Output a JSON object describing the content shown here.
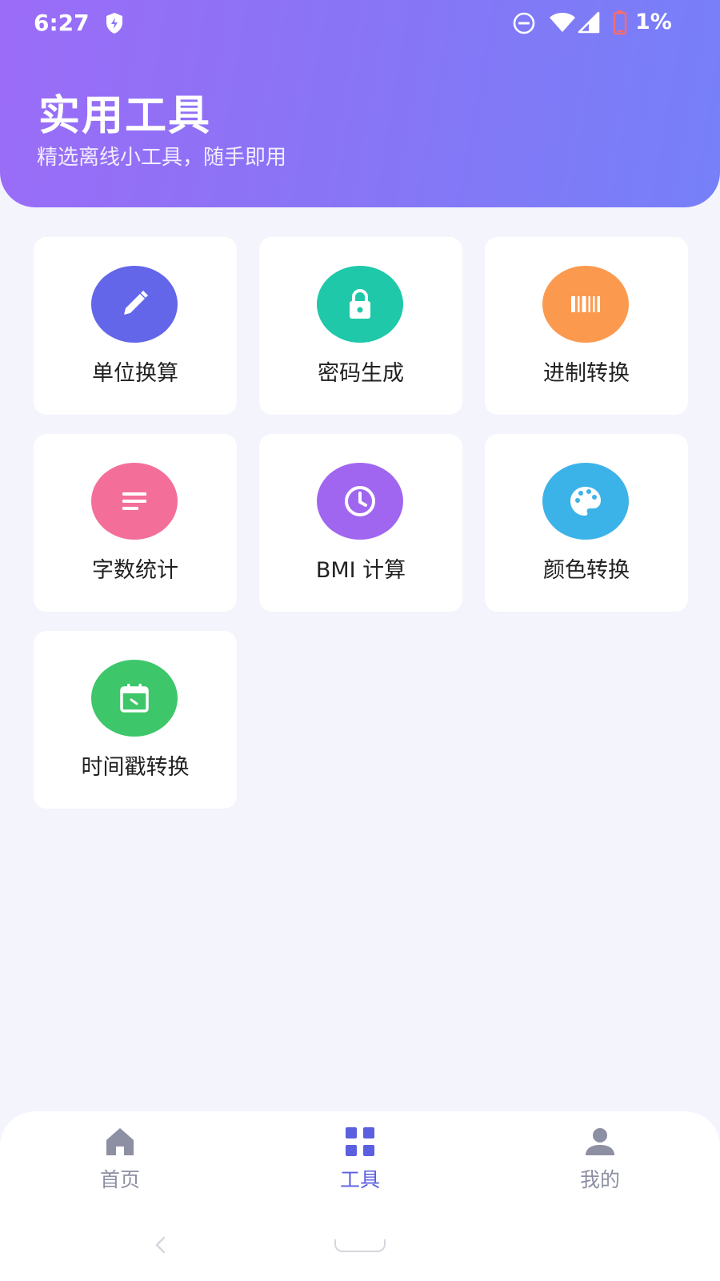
{
  "status_bar": {
    "time": "6:27",
    "battery_percent": "1%",
    "battery_level": 0.01,
    "icons": [
      "shield-icon",
      "do-not-disturb-icon",
      "wifi-icon",
      "signal-icon",
      "battery-icon"
    ]
  },
  "header": {
    "title": "实用工具",
    "subtitle": "精选离线小工具，随手即用",
    "gradient_colors": [
      "#9b6cf7",
      "#7680f8"
    ]
  },
  "tools": [
    {
      "label": "单位换算",
      "icon": "pencil-icon",
      "color": "#6366e8"
    },
    {
      "label": "密码生成",
      "icon": "lock-icon",
      "color": "#1ec8a8"
    },
    {
      "label": "进制转换",
      "icon": "barcode-icon",
      "color": "#fb9a4f"
    },
    {
      "label": "字数统计",
      "icon": "text-lines-icon",
      "color": "#f46e9a"
    },
    {
      "label": "BMI 计算",
      "icon": "clock-icon",
      "color": "#a066f0"
    },
    {
      "label": "颜色转换",
      "icon": "palette-icon",
      "color": "#3cb3e8"
    },
    {
      "label": "时间戳转换",
      "icon": "calendar-icon",
      "color": "#3ec66a"
    }
  ],
  "bottom_nav": {
    "items": [
      {
        "label": "首页",
        "icon": "home-icon",
        "active": false
      },
      {
        "label": "工具",
        "icon": "grid-icon",
        "active": true
      },
      {
        "label": "我的",
        "icon": "person-icon",
        "active": false
      }
    ],
    "active_color": "#5b5fe0",
    "inactive_color": "#8d8fa3"
  }
}
